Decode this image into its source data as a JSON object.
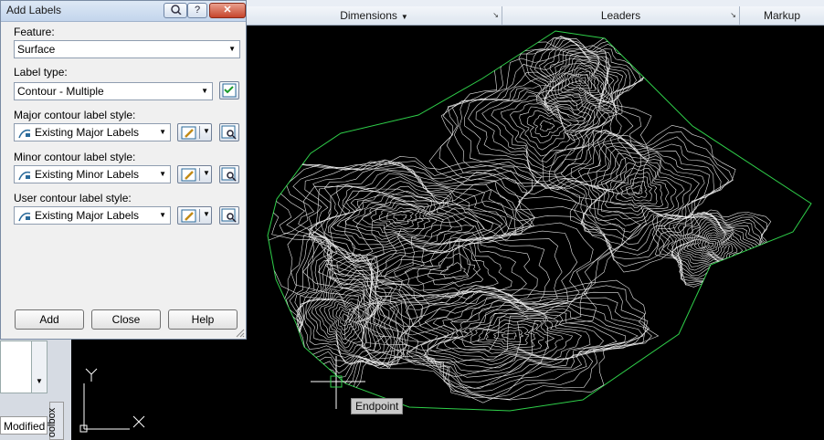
{
  "dialog": {
    "title": "Add Labels",
    "feature_label": "Feature:",
    "feature_value": "Surface",
    "label_type_label": "Label type:",
    "label_type_value": "Contour - Multiple",
    "major_label": "Major contour label style:",
    "major_value": "Existing Major Labels",
    "minor_label": "Minor contour label style:",
    "minor_value": "Existing Minor Labels",
    "user_label": "User contour label style:",
    "user_value": "Existing Major Labels",
    "help_glyph": "?",
    "close_glyph": "✕",
    "buttons": {
      "add": "Add",
      "close": "Close",
      "help": "Help"
    }
  },
  "ribbon": {
    "panels": [
      {
        "label": "Dimensions",
        "has_dropdown": true
      },
      {
        "label": "Leaders",
        "has_dropdown": false
      },
      {
        "label": "Markup",
        "has_dropdown": false
      }
    ]
  },
  "drawing": {
    "tooltip": "Endpoint",
    "ucs_y": "Y",
    "ucs_x": "X"
  },
  "left_panel": {
    "modified": "Modified",
    "toolbox_tab": "oolbox"
  },
  "colors": {
    "boundary": "#2fd04a",
    "contours": "#e8e8e8",
    "background": "#000000",
    "ucs": "#ffffff"
  }
}
